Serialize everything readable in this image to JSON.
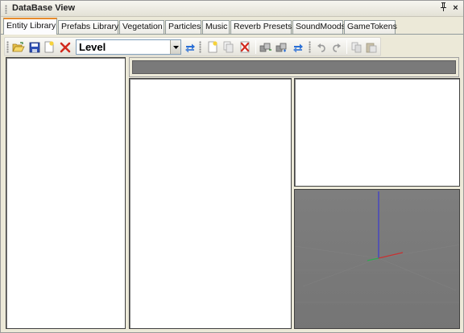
{
  "window": {
    "title": "DataBase View",
    "pin_glyph": "⭋",
    "close_glyph": "×"
  },
  "tabs": [
    {
      "label": "Entity Library",
      "active": true
    },
    {
      "label": "Prefabs Library",
      "active": false
    },
    {
      "label": "Vegetation",
      "active": false
    },
    {
      "label": "Particles",
      "active": false
    },
    {
      "label": "Music",
      "active": false
    },
    {
      "label": "Reverb Presets",
      "active": false
    },
    {
      "label": "SoundMoods",
      "active": false
    },
    {
      "label": "GameTokens",
      "active": false
    }
  ],
  "toolbar": {
    "level_select_value": "Level",
    "buttons": [
      {
        "icon": "open-folder-icon"
      },
      {
        "icon": "save-icon"
      },
      {
        "icon": "new-library-icon"
      },
      {
        "icon": "delete-library-icon"
      },
      {
        "icon": "reload-icon"
      },
      {
        "icon": "add-item-icon"
      },
      {
        "icon": "clone-item-icon"
      },
      {
        "icon": "remove-item-icon"
      },
      {
        "icon": "assign-to-selection-icon"
      },
      {
        "icon": "get-from-selection-icon"
      },
      {
        "icon": "refresh-icon"
      },
      {
        "icon": "undo-icon"
      },
      {
        "icon": "redo-icon"
      },
      {
        "icon": "copy-icon"
      },
      {
        "icon": "paste-icon"
      }
    ]
  },
  "colors": {
    "active_tab_accent": "#e68b2c",
    "viewport_background": "#7b7b7b",
    "axis_x": "#c83232",
    "axis_y": "#2fa84f",
    "axis_z": "#3a3ad0"
  }
}
